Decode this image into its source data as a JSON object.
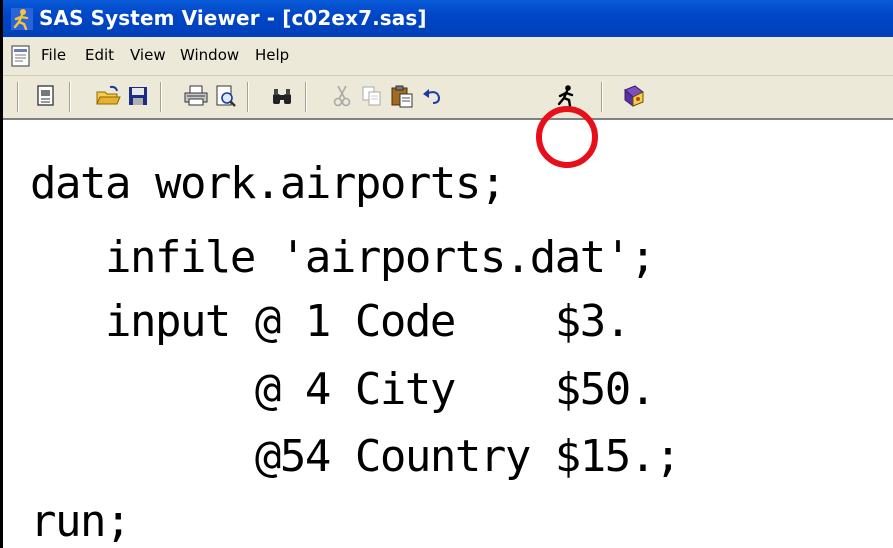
{
  "window": {
    "title": "SAS System Viewer - [c02ex7.sas]",
    "app_icon": "sas-runner-icon"
  },
  "menu": {
    "doc_icon": "document-icon",
    "items": [
      "File",
      "Edit",
      "View",
      "Window",
      "Help"
    ]
  },
  "toolbar": {
    "buttons": [
      "new-icon",
      "open-icon",
      "save-icon",
      "print-icon",
      "print-preview-icon",
      "find-icon",
      "cut-icon",
      "copy-icon",
      "paste-icon",
      "undo-icon",
      "submit-run-icon",
      "help-icon"
    ],
    "highlighted": "submit-run-icon",
    "highlight_color": "#e60f1a"
  },
  "editor": {
    "lines": [
      "data work.airports;",
      "   infile 'airports.dat';",
      "   input @ 1 Code    $3.",
      "         @ 4 City    $50.",
      "         @54 Country $15.;",
      "run;"
    ]
  }
}
